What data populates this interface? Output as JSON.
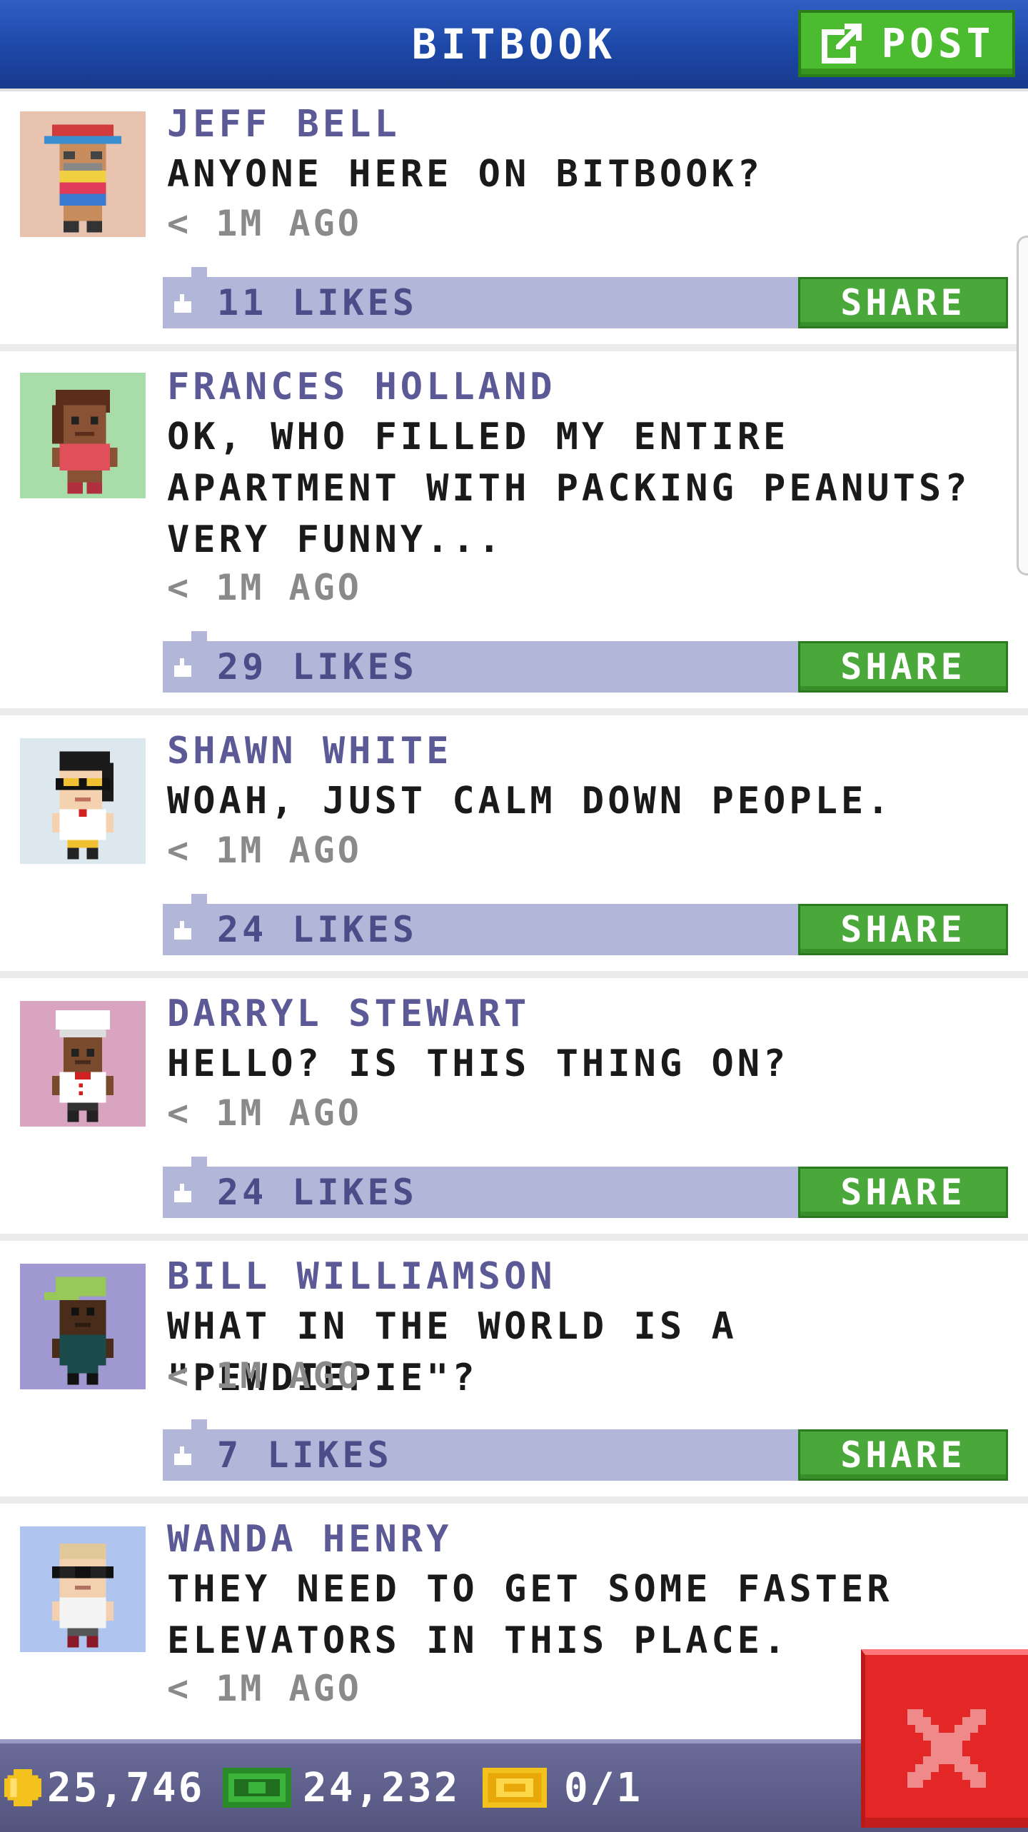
{
  "header": {
    "title": "BITBOOK",
    "post_label": "POST"
  },
  "posts": [
    {
      "name": "JEFF BELL",
      "message": "ANYONE HERE ON BITBOOK?",
      "time": "< 1M AGO",
      "likes": "11 LIKES",
      "share": "SHARE",
      "avatar_bg": "#e8c4b0"
    },
    {
      "name": "FRANCES HOLLAND",
      "message": "OK, WHO FILLED MY ENTIRE APARTMENT WITH PACKING PEANUTS? VERY FUNNY...",
      "time": "< 1M AGO",
      "likes": "29 LIKES",
      "share": "SHARE",
      "avatar_bg": "#a8dca8"
    },
    {
      "name": "SHAWN WHITE",
      "message": "WOAH, JUST CALM DOWN PEOPLE.",
      "time": "< 1M AGO",
      "likes": "24 LIKES",
      "share": "SHARE",
      "avatar_bg": "#dde8ee"
    },
    {
      "name": "DARRYL STEWART",
      "message": "HELLO? IS THIS THING ON?",
      "time": "< 1M AGO",
      "likes": "24 LIKES",
      "share": "SHARE",
      "avatar_bg": "#d8a4c0"
    },
    {
      "name": "BILL WILLIAMSON",
      "message": "WHAT IN THE WORLD IS A \"PEWDIEPIE\"?",
      "time": "< 1M AGO",
      "likes": "7 LIKES",
      "share": "SHARE",
      "avatar_bg": "#a098d0"
    },
    {
      "name": "WANDA HENRY",
      "message": "THEY NEED TO GET SOME FASTER ELEVATORS IN THIS PLACE.",
      "time": "< 1M AGO",
      "avatar_bg": "#b0c4f0"
    }
  ],
  "footer": {
    "coins": "25,746",
    "bux": "24,232",
    "tickets": "0/1"
  },
  "icons": {
    "post": "compose-icon",
    "like": "thumbs-up-icon",
    "coin": "coin-icon",
    "bux": "bux-icon",
    "ticket": "golden-ticket-icon",
    "close": "close-icon"
  },
  "colors": {
    "header": "#1d47a7",
    "accent_green": "#4aa83a",
    "like_bar": "#b2b6d9",
    "name": "#5c5a96",
    "close_red": "#e32727",
    "footer": "#5b5c88"
  }
}
